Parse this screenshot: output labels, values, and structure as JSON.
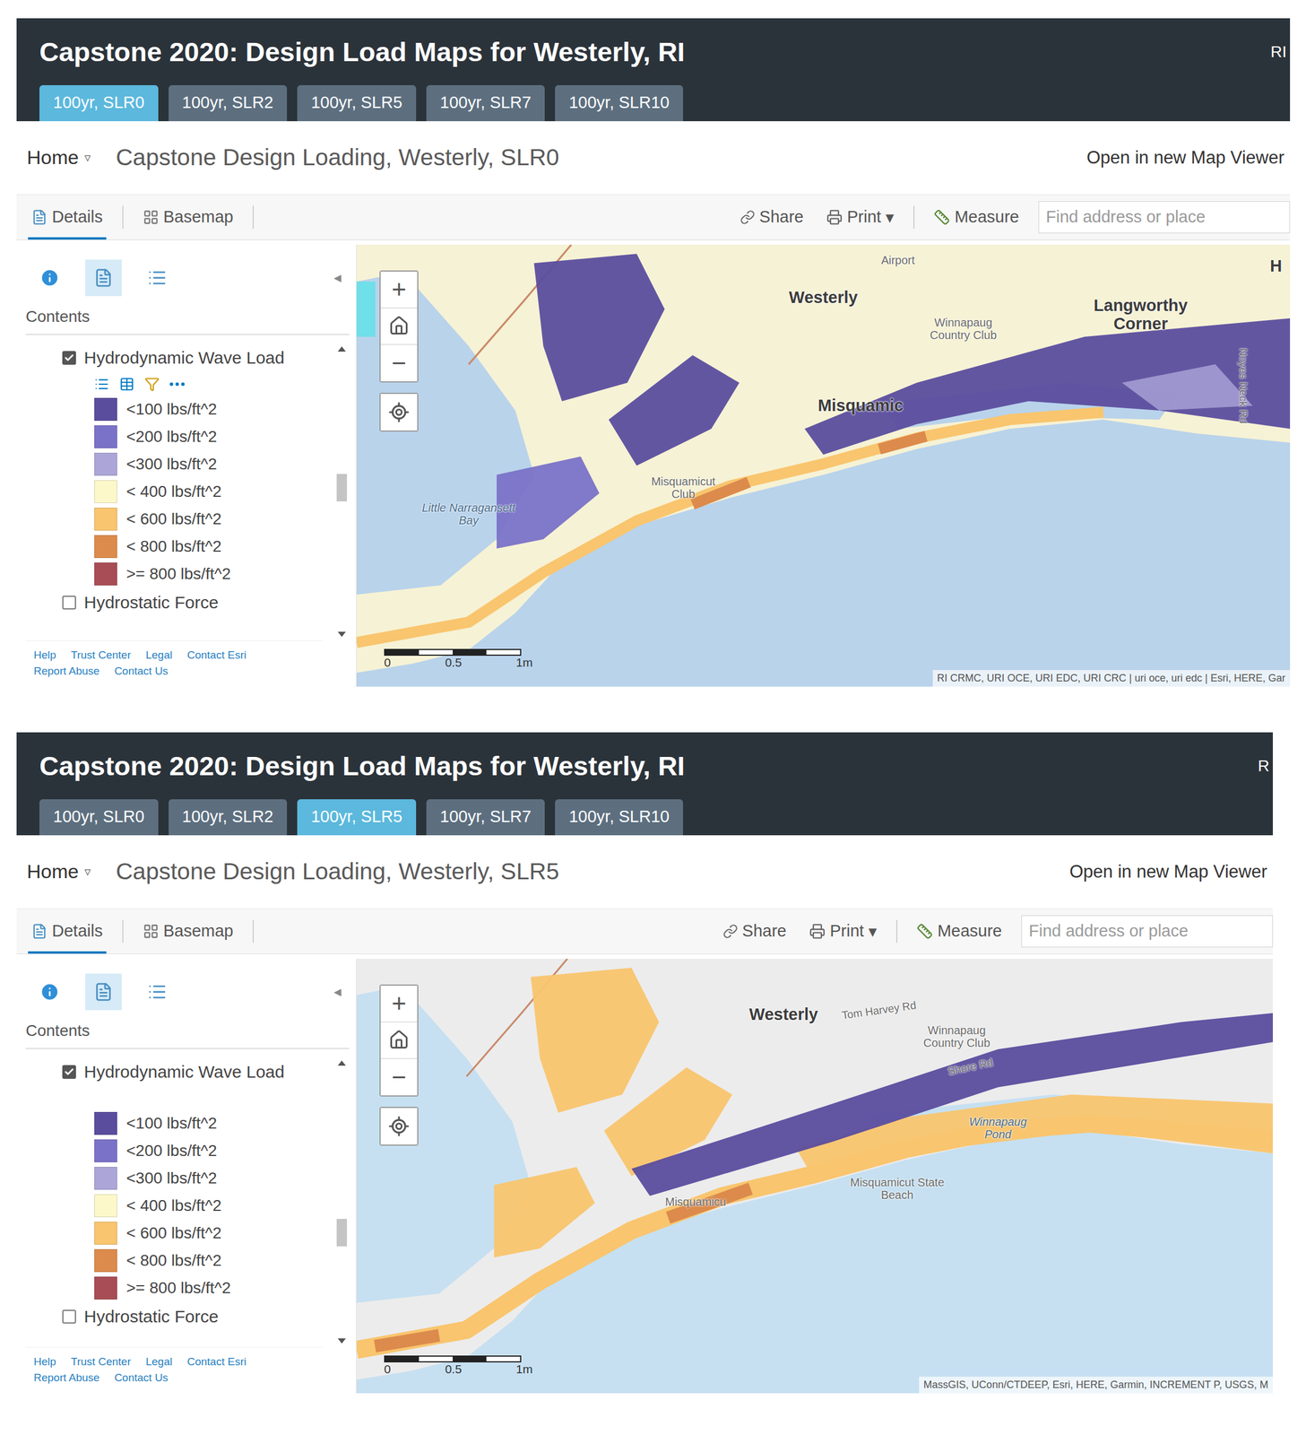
{
  "panels": [
    {
      "header": {
        "title": "Capstone 2020: Design Load Maps for Westerly, RI",
        "corner": "RI"
      },
      "tabs": [
        {
          "label": "100yr, SLR0",
          "selected": true
        },
        {
          "label": "100yr, SLR2",
          "selected": false
        },
        {
          "label": "100yr, SLR5",
          "selected": false
        },
        {
          "label": "100yr, SLR7",
          "selected": false
        },
        {
          "label": "100yr, SLR10",
          "selected": false
        }
      ],
      "breadcrumb": {
        "home": "Home",
        "caret": "▿",
        "title": "Capstone Design Loading, Westerly, SLR0",
        "open": "Open in new Map Viewer"
      },
      "toolbar": {
        "details": "Details",
        "basemap": "Basemap",
        "share": "Share",
        "print": "Print",
        "print_caret": "▾",
        "measure": "Measure",
        "search_placeholder": "Find address or place"
      },
      "sidebar": {
        "contents": "Contents",
        "collapse": "◂",
        "scroll": {
          "level": 0.55
        },
        "layers": [
          {
            "name": "Hydrodynamic Wave Load",
            "checked": true,
            "show_tools": true,
            "legend": [
              {
                "label": "<100 lbs/ft^2",
                "color": "#5b4d9e"
              },
              {
                "label": "<200 lbs/ft^2",
                "color": "#7a72c8"
              },
              {
                "label": "<300 lbs/ft^2",
                "color": "#aba5d8"
              },
              {
                "label": "< 400 lbs/ft^2",
                "color": "#fdf8c9"
              },
              {
                "label": "< 600 lbs/ft^2",
                "color": "#f9c56e"
              },
              {
                "label": "< 800 lbs/ft^2",
                "color": "#dc8b4c"
              },
              {
                "label": ">= 800 lbs/ft^2",
                "color": "#a84d55"
              }
            ]
          },
          {
            "name": "Hydrostatic Force",
            "checked": false,
            "show_tools": false,
            "legend": []
          }
        ],
        "footer_links": [
          "Help",
          "Trust Center",
          "Legal",
          "Contact Esri",
          "Report Abuse",
          "Contact Us"
        ]
      },
      "map": {
        "basemap": "topographic",
        "zoom_in": "+",
        "zoom_out": "−",
        "labels": [
          {
            "text": "Westerly",
            "kind": "place"
          },
          {
            "text": "Langworthy Corner",
            "kind": "place"
          },
          {
            "text": "Misquamic",
            "kind": "place"
          },
          {
            "text": "Winnapaug Country Club",
            "kind": "poi"
          },
          {
            "text": "Little Narragansett Bay",
            "kind": "water"
          },
          {
            "text": "Misquamicut Club",
            "kind": "poi"
          },
          {
            "text": "Airport",
            "kind": "poi"
          },
          {
            "text": "H",
            "kind": "place"
          },
          {
            "text": "Noyes Neck Rd",
            "kind": "road"
          }
        ],
        "scale": [
          "0",
          "0.5",
          "1m"
        ],
        "attribution": "RI CRMC, URI OCE, URI EDC, URI CRC | uri oce, uri edc | Esri, HERE, Gar"
      }
    },
    {
      "header": {
        "title": "Capstone 2020: Design Load Maps for Westerly, RI",
        "corner": "R"
      },
      "tabs": [
        {
          "label": "100yr, SLR0",
          "selected": false
        },
        {
          "label": "100yr, SLR2",
          "selected": false
        },
        {
          "label": "100yr, SLR5",
          "selected": true
        },
        {
          "label": "100yr, SLR7",
          "selected": false
        },
        {
          "label": "100yr, SLR10",
          "selected": false
        }
      ],
      "breadcrumb": {
        "home": "Home",
        "caret": "▿",
        "title": "Capstone Design Loading, Westerly, SLR5",
        "open": "Open in new Map Viewer"
      },
      "toolbar": {
        "details": "Details",
        "basemap": "Basemap",
        "share": "Share",
        "print": "Print",
        "print_caret": "▾",
        "measure": "Measure",
        "search_placeholder": "Find address or place"
      },
      "sidebar": {
        "contents": "Contents",
        "collapse": "◂",
        "scroll": {
          "level": 0.7
        },
        "layers": [
          {
            "name": "Hydrodynamic Wave Load",
            "checked": true,
            "show_tools": false,
            "legend": [
              {
                "label": "<100 lbs/ft^2",
                "color": "#5b4d9e"
              },
              {
                "label": "<200 lbs/ft^2",
                "color": "#7a72c8"
              },
              {
                "label": "<300 lbs/ft^2",
                "color": "#aba5d8"
              },
              {
                "label": "< 400 lbs/ft^2",
                "color": "#fdf8c9"
              },
              {
                "label": "< 600 lbs/ft^2",
                "color": "#f9c56e"
              },
              {
                "label": "< 800 lbs/ft^2",
                "color": "#dc8b4c"
              },
              {
                "label": ">= 800 lbs/ft^2",
                "color": "#a84d55"
              }
            ]
          },
          {
            "name": "Hydrostatic Force",
            "checked": false,
            "show_tools": false,
            "legend": []
          }
        ],
        "footer_links": [
          "Help",
          "Trust Center",
          "Legal",
          "Contact Esri",
          "Report Abuse",
          "Contact Us"
        ]
      },
      "map": {
        "basemap": "light-gray",
        "zoom_in": "+",
        "zoom_out": "−",
        "labels": [
          {
            "text": "Westerly",
            "kind": "place"
          },
          {
            "text": "Tom Harvey Rd",
            "kind": "road"
          },
          {
            "text": "Winnapaug Country Club",
            "kind": "poi"
          },
          {
            "text": "Shore Rd",
            "kind": "road"
          },
          {
            "text": "Winnapaug Pond",
            "kind": "water"
          },
          {
            "text": "Misquamicut State Beach",
            "kind": "poi"
          },
          {
            "text": "Misquamicu",
            "kind": "poi"
          }
        ],
        "scale": [
          "0",
          "0.5",
          "1m"
        ],
        "attribution": "MassGIS, UConn/CTDEEP, Esri, HERE, Garmin, INCREMENT P, USGS, M"
      }
    }
  ]
}
